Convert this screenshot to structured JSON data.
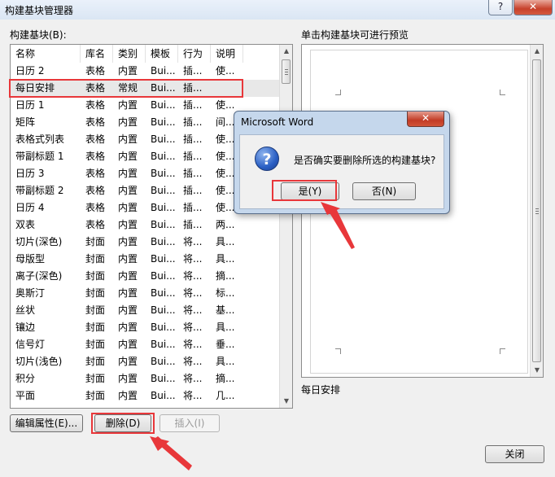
{
  "window": {
    "title": "构建基块管理器",
    "help": "?",
    "close": "✕"
  },
  "list": {
    "label": "构建基块(B):",
    "columns": [
      "名称",
      "库名",
      "类别",
      "模板",
      "行为",
      "说明"
    ],
    "rows": [
      [
        "日历 2",
        "表格",
        "内置",
        "Bui...",
        "插...",
        "使..."
      ],
      [
        "每日安排",
        "表格",
        "常规",
        "Bui...",
        "插...",
        ""
      ],
      [
        "日历 1",
        "表格",
        "内置",
        "Bui...",
        "插...",
        "使..."
      ],
      [
        "矩阵",
        "表格",
        "内置",
        "Bui...",
        "插...",
        "间..."
      ],
      [
        "表格式列表",
        "表格",
        "内置",
        "Bui...",
        "插...",
        "使..."
      ],
      [
        "带副标题 1",
        "表格",
        "内置",
        "Bui...",
        "插...",
        "使..."
      ],
      [
        "日历 3",
        "表格",
        "内置",
        "Bui...",
        "插...",
        "使..."
      ],
      [
        "带副标题 2",
        "表格",
        "内置",
        "Bui...",
        "插...",
        "使..."
      ],
      [
        "日历 4",
        "表格",
        "内置",
        "Bui...",
        "插...",
        "使..."
      ],
      [
        "双表",
        "表格",
        "内置",
        "Bui...",
        "插...",
        "两..."
      ],
      [
        "切片(深色)",
        "封面",
        "内置",
        "Bui...",
        "将...",
        "具..."
      ],
      [
        "母版型",
        "封面",
        "内置",
        "Bui...",
        "将...",
        "具..."
      ],
      [
        "离子(深色)",
        "封面",
        "内置",
        "Bui...",
        "将...",
        "摘..."
      ],
      [
        "奥斯汀",
        "封面",
        "内置",
        "Bui...",
        "将...",
        "标..."
      ],
      [
        "丝状",
        "封面",
        "内置",
        "Bui...",
        "将...",
        "基..."
      ],
      [
        "镶边",
        "封面",
        "内置",
        "Bui...",
        "将...",
        "具..."
      ],
      [
        "信号灯",
        "封面",
        "内置",
        "Bui...",
        "将...",
        "垂..."
      ],
      [
        "切片(浅色)",
        "封面",
        "内置",
        "Bui...",
        "将...",
        "具..."
      ],
      [
        "积分",
        "封面",
        "内置",
        "Bui...",
        "将...",
        "摘..."
      ],
      [
        "平面",
        "封面",
        "内置",
        "Bui...",
        "将...",
        "几..."
      ]
    ],
    "selected_index": 1
  },
  "buttons": {
    "edit": "编辑属性(E)...",
    "delete": "删除(D)",
    "insert": "插入(I)",
    "close": "关闭"
  },
  "preview": {
    "label": "单击构建基块可进行预览",
    "caption": "每日安排"
  },
  "dialog": {
    "title": "Microsoft Word",
    "message": "是否确实要删除所选的构建基块?",
    "yes": "是(Y)",
    "no": "否(N)",
    "icon": "question-icon"
  },
  "colors": {
    "highlight": "#e8373a",
    "accent": "#2a5fc4"
  }
}
